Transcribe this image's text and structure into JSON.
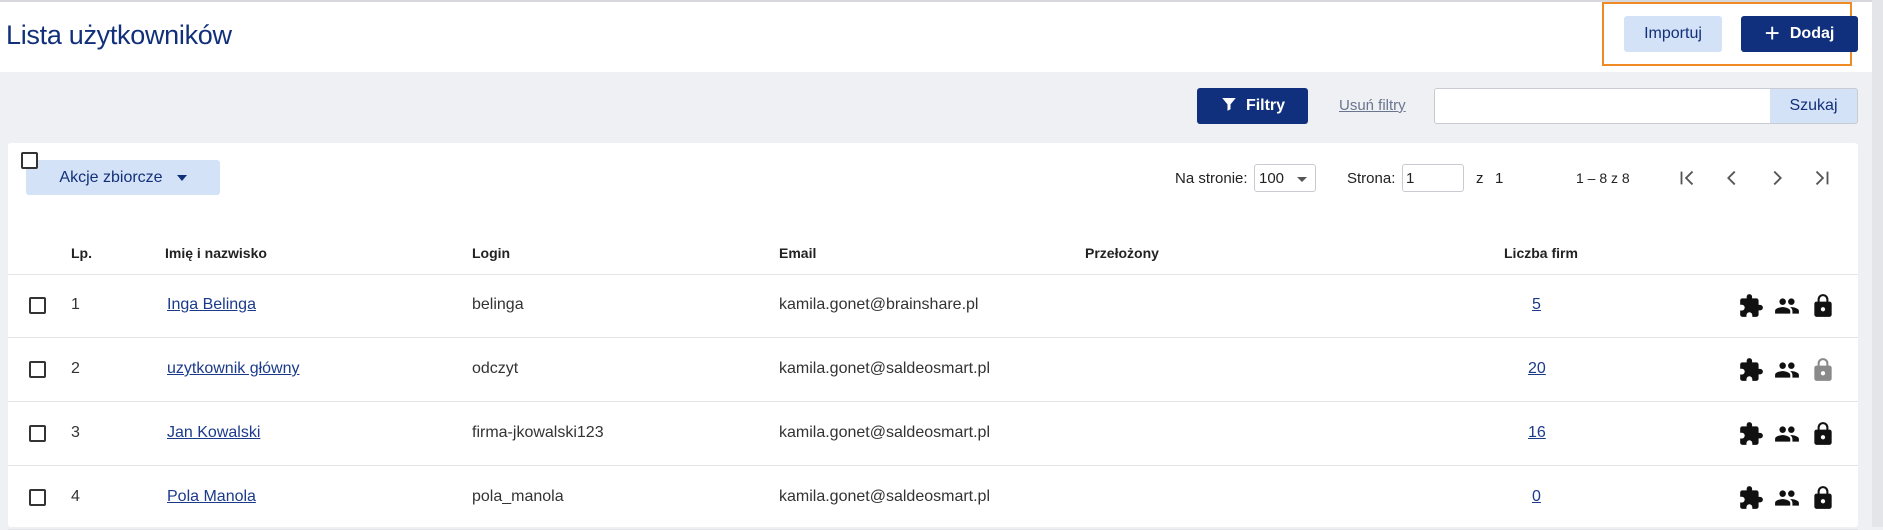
{
  "header": {
    "title": "Lista użytkowników",
    "import_label": "Importuj",
    "add_label": "Dodaj"
  },
  "filters": {
    "filters_label": "Filtry",
    "clear_label": "Usuń filtry",
    "search_placeholder": "",
    "search_label": "Szukaj"
  },
  "toolbar": {
    "bulk_label": "Akcje zbiorcze",
    "per_page_label": "Na stronie:",
    "per_page_value": "100",
    "page_label": "Strona:",
    "page_value": "1",
    "of_label": "z",
    "total_pages": "1",
    "range_text": "1 – 8 z 8"
  },
  "table": {
    "columns": [
      "Lp.",
      "Imię i nazwisko",
      "Login",
      "Email",
      "Przełożony",
      "Liczba firm"
    ],
    "rows": [
      {
        "lp": "1",
        "name": "Inga Belinga",
        "login": "belinga",
        "email": "kamila.gonet@brainshare.pl",
        "supervisor": "",
        "companies": "5",
        "lock_active": true
      },
      {
        "lp": "2",
        "name": "uzytkownik główny",
        "login": "odczyt",
        "email": "kamila.gonet@saldeosmart.pl",
        "supervisor": "",
        "companies": "20",
        "lock_active": false
      },
      {
        "lp": "3",
        "name": "Jan Kowalski",
        "login": "firma-jkowalski123",
        "email": "kamila.gonet@saldeosmart.pl",
        "supervisor": "",
        "companies": "16",
        "lock_active": true
      },
      {
        "lp": "4",
        "name": "Pola Manola",
        "login": "pola_manola",
        "email": "kamila.gonet@saldeosmart.pl",
        "supervisor": "",
        "companies": "0",
        "lock_active": true
      }
    ]
  },
  "colors": {
    "primary": "#10307e",
    "secondary_bg": "#d4e2f7",
    "highlight": "#f08a24",
    "icon_disabled": "#8a8a8a"
  },
  "icons": {
    "filter": "filter-icon",
    "add": "plus-icon",
    "row_actions": [
      "puzzle-icon",
      "people-icon",
      "lock-icon"
    ]
  }
}
